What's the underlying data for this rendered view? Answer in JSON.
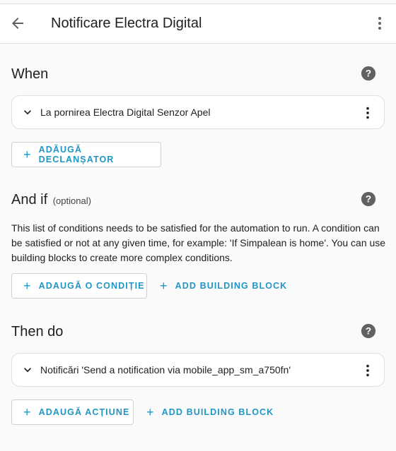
{
  "appbar": {
    "title": "Notificare Electra Digital",
    "back_icon": "arrow-left-icon",
    "menu_icon": "dots-vertical-icon"
  },
  "triggers": {
    "title": "When",
    "items": [
      {
        "label": "La pornirea Electra Digital Senzor Apel"
      }
    ],
    "add_label": "ADĂUGĂ DECLANȘATOR"
  },
  "conditions": {
    "title": "And if",
    "optional_label": "(optional)",
    "description": "This list of conditions needs to be satisfied for the automation to run. A condition can be satisfied or not at any given time, for example: 'If Simpalean is home'. You can use building blocks to create more complex conditions.",
    "add_label": "ADAUGĂ O CONDIȚIE",
    "building_block_label": "ADD BUILDING BLOCK"
  },
  "actions": {
    "title": "Then do",
    "items": [
      {
        "label": "Notificări 'Send a notification via mobile_app_sm_a750fn'"
      }
    ],
    "add_label": "ADAUGĂ ACȚIUNE",
    "building_block_label": "ADD BUILDING BLOCK"
  },
  "colors": {
    "accent": "#2196c4",
    "help_icon": "#616161"
  }
}
